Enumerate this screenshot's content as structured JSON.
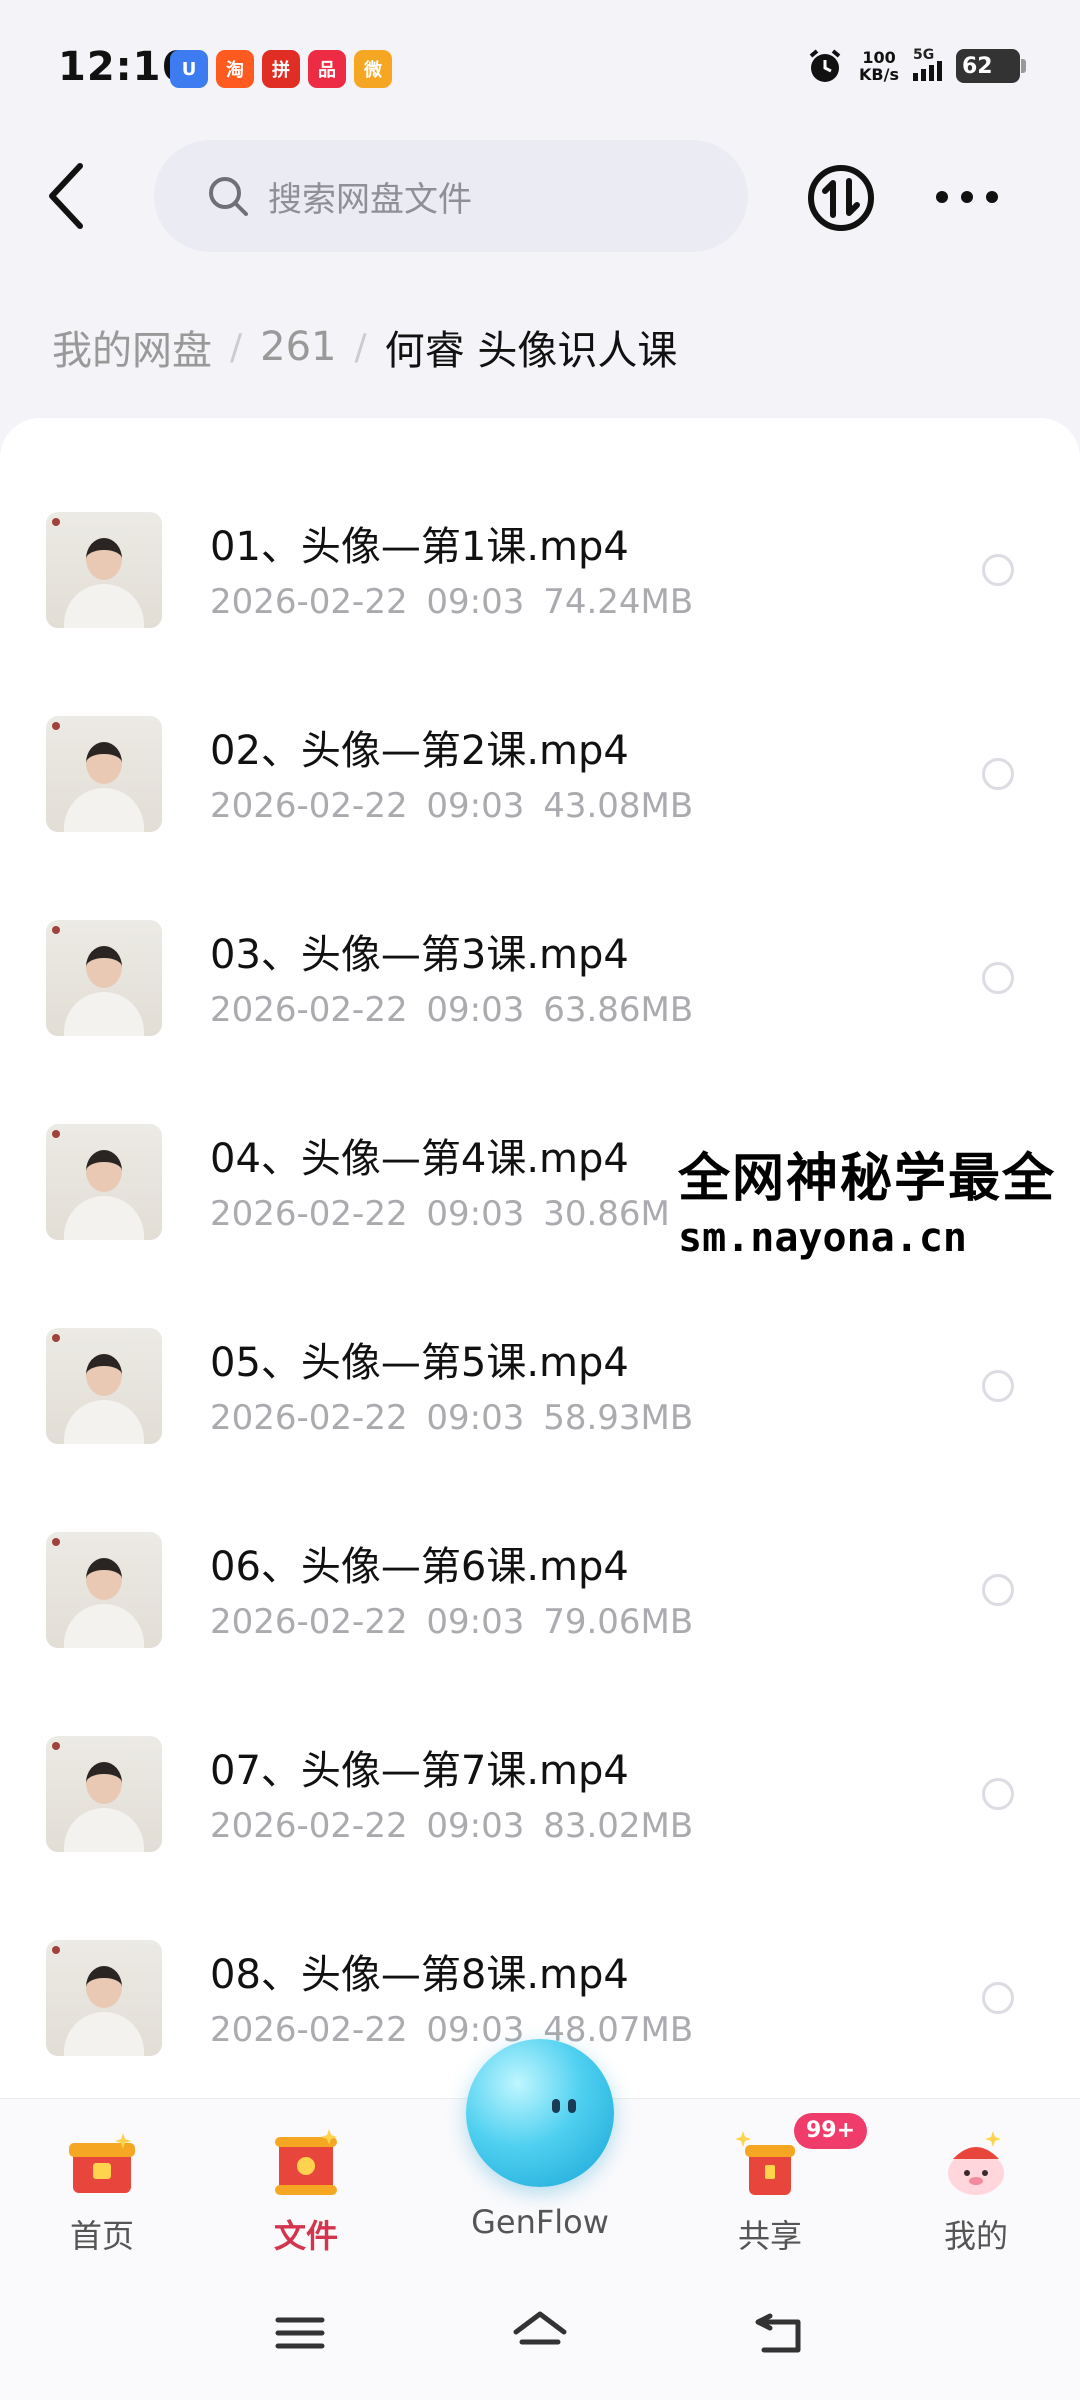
{
  "status_bar": {
    "time": "12:16",
    "notification_icons": [
      {
        "icon": "shield-app-icon",
        "color": "#3d7cf0",
        "glyph": "U"
      },
      {
        "icon": "taobao-app-icon",
        "color": "#ff5a1f",
        "glyph": "淘"
      },
      {
        "icon": "pinduoduo-app-icon",
        "color": "#e02e24",
        "glyph": "拼"
      },
      {
        "icon": "mall-app-icon",
        "color": "#ee2b45",
        "glyph": "品"
      },
      {
        "icon": "weibo-app-icon",
        "color": "#f5a623",
        "glyph": "微"
      }
    ],
    "speed_value": "100",
    "speed_unit": "KB/s",
    "network": "5G",
    "battery": "62"
  },
  "header": {
    "search_placeholder": "搜索网盘文件"
  },
  "breadcrumb": {
    "root": "我的网盘",
    "folder": "261",
    "current": "何睿 头像识人课"
  },
  "files": [
    {
      "name": "01、头像—第1课.mp4",
      "date": "2026-02-22",
      "time": "09:03",
      "size": "74.24MB"
    },
    {
      "name": "02、头像—第2课.mp4",
      "date": "2026-02-22",
      "time": "09:03",
      "size": "43.08MB"
    },
    {
      "name": "03、头像—第3课.mp4",
      "date": "2026-02-22",
      "time": "09:03",
      "size": "63.86MB"
    },
    {
      "name": "04、头像—第4课.mp4",
      "date": "2026-02-22",
      "time": "09:03",
      "size": "30.86MB"
    },
    {
      "name": "05、头像—第5课.mp4",
      "date": "2026-02-22",
      "time": "09:03",
      "size": "58.93MB"
    },
    {
      "name": "06、头像—第6课.mp4",
      "date": "2026-02-22",
      "time": "09:03",
      "size": "79.06MB"
    },
    {
      "name": "07、头像—第7课.mp4",
      "date": "2026-02-22",
      "time": "09:03",
      "size": "83.02MB"
    },
    {
      "name": "08、头像—第8课.mp4",
      "date": "2026-02-22",
      "time": "09:03",
      "size": "48.07MB"
    }
  ],
  "watermark": {
    "line1": "全网神秘学最全",
    "line2": "sm.nayona.cn"
  },
  "bottom_nav": {
    "home": "首页",
    "files": "文件",
    "genflow": "GenFlow",
    "share": "共享",
    "share_badge": "99+",
    "mine": "我的",
    "active": "files",
    "accent_color": "#d2354d"
  }
}
